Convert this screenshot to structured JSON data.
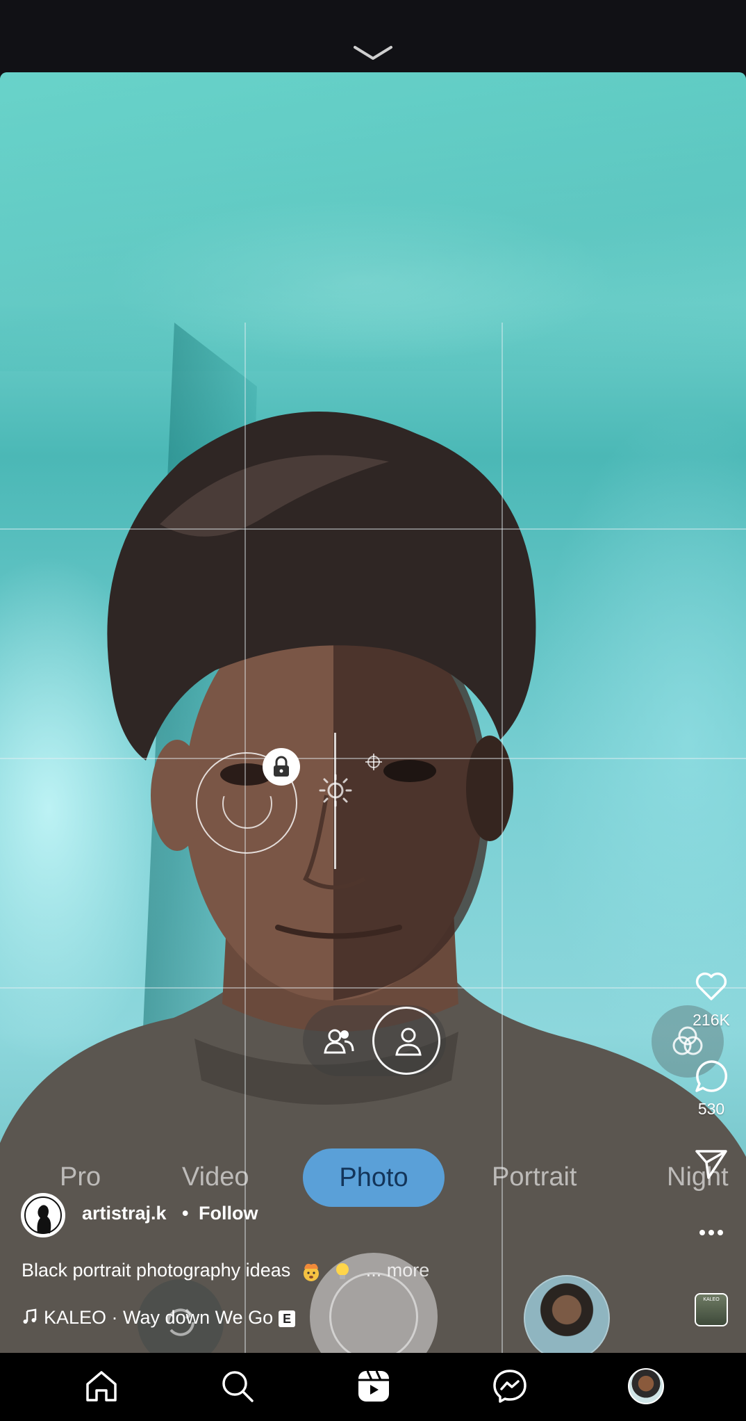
{
  "top_bar": {
    "collapse_icon": "chevron-down-icon"
  },
  "camera_overlay": {
    "modes": [
      "Pro",
      "Video",
      "Photo",
      "Portrait",
      "Night"
    ],
    "active_mode": "Photo"
  },
  "actions": {
    "likes": "216K",
    "comments": "530"
  },
  "post": {
    "username": "artistraj.k",
    "separator": "•",
    "follow_label": "Follow",
    "caption": "Black portrait photography ideas",
    "caption_more": "... more",
    "audio_track": "KALEO · Way down We Go",
    "explicit_badge": "E",
    "audio_thumb_text": "KALEO"
  },
  "bottom_nav": {
    "items": [
      "home-icon",
      "search-icon",
      "reels-icon",
      "messenger-icon",
      "profile-avatar"
    ],
    "active": "reels-icon"
  },
  "colors": {
    "wall": "#6fd0cb",
    "photo_pill": "#5aa0d8",
    "nav_bg": "#000000",
    "top_bg": "#111115"
  }
}
